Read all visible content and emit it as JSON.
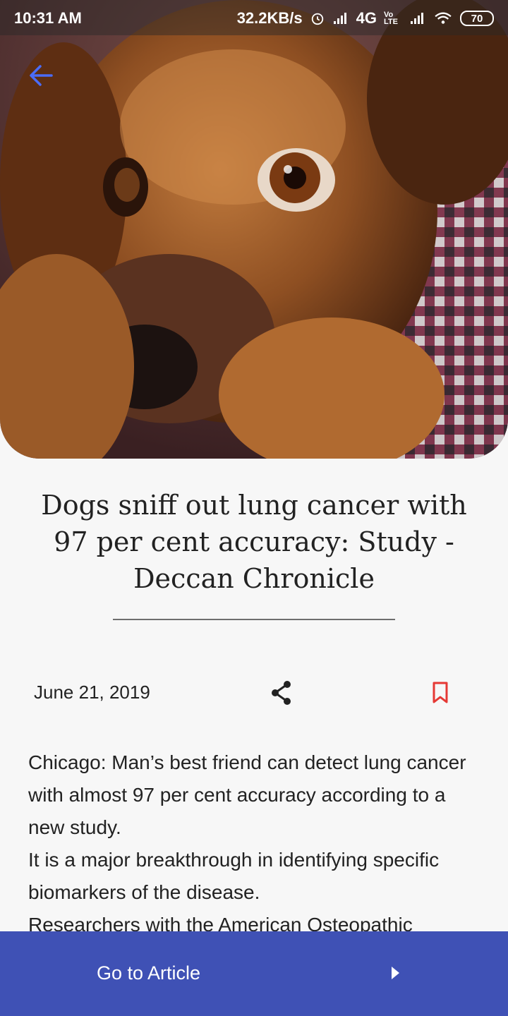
{
  "status_bar": {
    "time": "10:31 AM",
    "network_speed": "32.2KB/s",
    "network_type": "4G",
    "volte": "Vo LTE",
    "battery": "70",
    "icons": [
      "alarm-icon",
      "signal-icon",
      "wifi-icon",
      "battery-icon"
    ]
  },
  "header": {
    "back_icon": "arrow-left-icon",
    "accent_color": "#4a6cf7"
  },
  "article": {
    "title": "Dogs sniff out lung cancer with 97 per cent accuracy: Study - Deccan Chronicle",
    "date": "June 21, 2019",
    "share_icon": "share-icon",
    "bookmark_icon": "bookmark-icon",
    "bookmark_color": "#e53935",
    "paragraphs": [
      "Chicago: Man’s best friend can detect lung cancer with almost 97 per cent accuracy according to a new study.",
      "It is a major breakthrough in identifying specific biomarkers of the disease.",
      "Researchers with the American Osteopathic"
    ]
  },
  "bottom_bar": {
    "label": "Go to Article",
    "icon": "play-arrow-icon",
    "color": "#3f51b5"
  }
}
